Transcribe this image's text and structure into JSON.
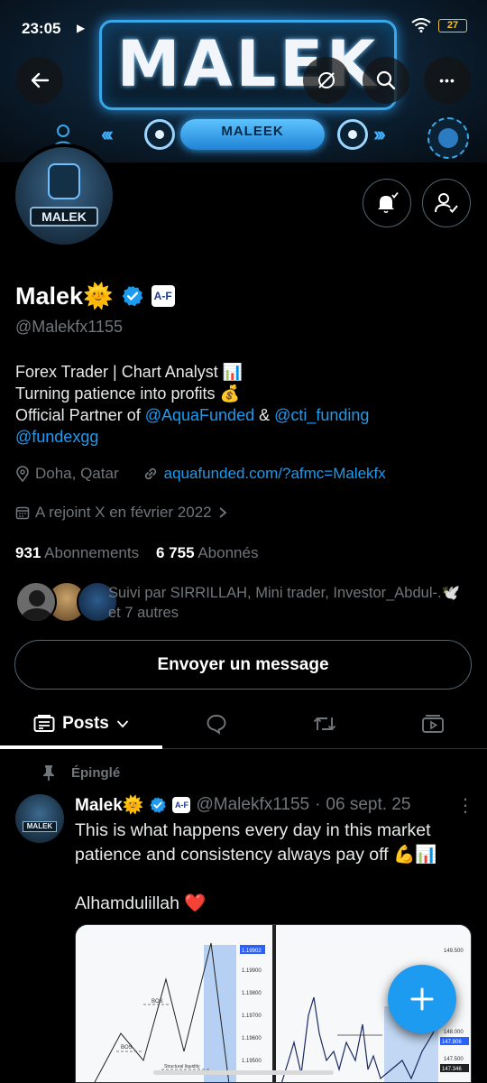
{
  "status_bar": {
    "time": "23:05",
    "nav_glyph": "▶",
    "battery": "27"
  },
  "banner": {
    "title": "MALEK",
    "pill_text": "MALEEK",
    "chevrons_left": "‹‹‹",
    "chevrons_right": "›››"
  },
  "header": {
    "back_icon": "arrow-left-icon",
    "more_glyph": "•••"
  },
  "avatar": {
    "label": "MALEK"
  },
  "profile": {
    "name": "Malek",
    "name_emoji": "🌞",
    "affiliate_badge": "A‑F",
    "handle": "@Malekfx1155",
    "bio_line1": "Forex Trader | Chart Analyst 📊",
    "bio_line2": "Turning patience into profits 💰",
    "bio_line3_prefix": "Official Partner of ",
    "bio_mention1": "@AquaFunded",
    "bio_amp": " & ",
    "bio_mention2": "@cti_funding",
    "bio_mention3": "@fundexgg",
    "location": "Doha, Qatar",
    "website": "aquafunded.com/?afmc=Malekfx",
    "joined": "A rejoint X en février 2022",
    "following_count": "931",
    "following_label": "Abonnements",
    "followers_count": "6 755",
    "followers_label": "Abonnés",
    "followed_by": "Suivi par SIRRILLAH, Mini trader, Investor_Abdul-.🕊️ et 7 autres"
  },
  "actions": {
    "message_label": "Envoyer un message"
  },
  "tabs": {
    "posts_label": "Posts"
  },
  "pinned_post": {
    "pinned_label": "Épinglé",
    "author_name": "Malek🌞",
    "author_handle": "@Malekfx1155",
    "separator": "·",
    "date": "06 sept. 25",
    "more_glyph": "⋮",
    "text_line1": "This is what happens every day in this market",
    "text_line2": "patience and consistency always pay off 💪📊",
    "text_line3": "Alhamdulillah ❤️",
    "avatar_label": "MALEK",
    "image": {
      "left_prices": [
        "1.19902",
        "1.19900",
        "1.19800",
        "1.19700",
        "1.19600",
        "1.19500"
      ],
      "right_prices": [
        "149.500",
        "148.000",
        "147.806",
        "147.500",
        "147.346"
      ],
      "labels": [
        "BOS",
        "BOS",
        "Structural liquidity"
      ]
    }
  },
  "colors": {
    "accent": "#1d9bf0",
    "muted": "#71767b",
    "border": "#536471",
    "background": "#000000"
  }
}
